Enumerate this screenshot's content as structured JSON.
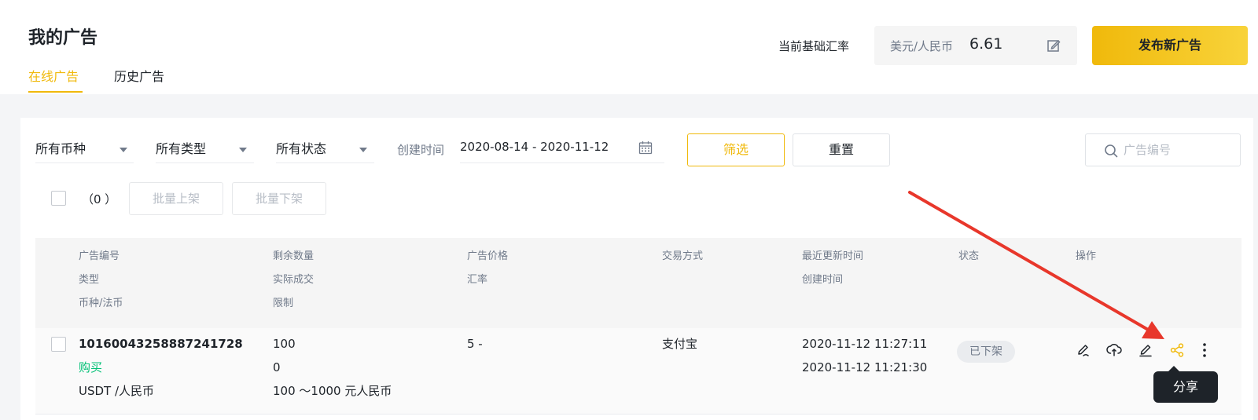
{
  "header": {
    "title": "我的广告",
    "tabs": [
      {
        "label": "在线广告",
        "active": true
      },
      {
        "label": "历史广告",
        "active": false
      }
    ],
    "rate_label": "当前基础汇率",
    "rate_currency": "美元/人民币",
    "rate_value": "6.61",
    "publish_label": "发布新广告"
  },
  "filters": {
    "coin": "所有币种",
    "type": "所有类型",
    "status": "所有状态",
    "date_label": "创建时间",
    "date_range": "2020-08-14 - 2020-11-12",
    "filter_label": "筛选",
    "reset_label": "重置",
    "search_placeholder": "广告编号"
  },
  "batch": {
    "selected_count": "（0 ）",
    "list_label": "批量上架",
    "delist_label": "批量下架"
  },
  "table": {
    "headers": {
      "ad_id": "广告编号",
      "type": "类型",
      "currency": "币种/法币",
      "remaining": "剩余数量",
      "actual": "实际成交",
      "limit": "限制",
      "price": "广告价格",
      "rate": "汇率",
      "payment": "交易方式",
      "updated": "最近更新时间",
      "created": "创建时间",
      "status": "状态",
      "actions": "操作"
    },
    "rows": [
      {
        "ad_id": "10160043258887241728",
        "type": "购买",
        "currency": "USDT /人民币",
        "remaining": "100",
        "actual": "0",
        "limit": "100 ～1000 元人民币",
        "price": "5 -",
        "payment": "支付宝",
        "updated": "2020-11-12 11:27:11",
        "created": "2020-11-12 11:21:30",
        "status": "已下架"
      }
    ]
  },
  "tooltip": "分享",
  "icons": [
    "edit-square-icon",
    "calendar-icon",
    "search-icon",
    "edit-price-icon",
    "upload-icon",
    "pencil-icon",
    "share-icon",
    "more-vertical-icon",
    "annotation-arrow"
  ],
  "colors": {
    "accent": "#f0b90b",
    "buy": "#02c076",
    "annotation": "#e8372b"
  }
}
